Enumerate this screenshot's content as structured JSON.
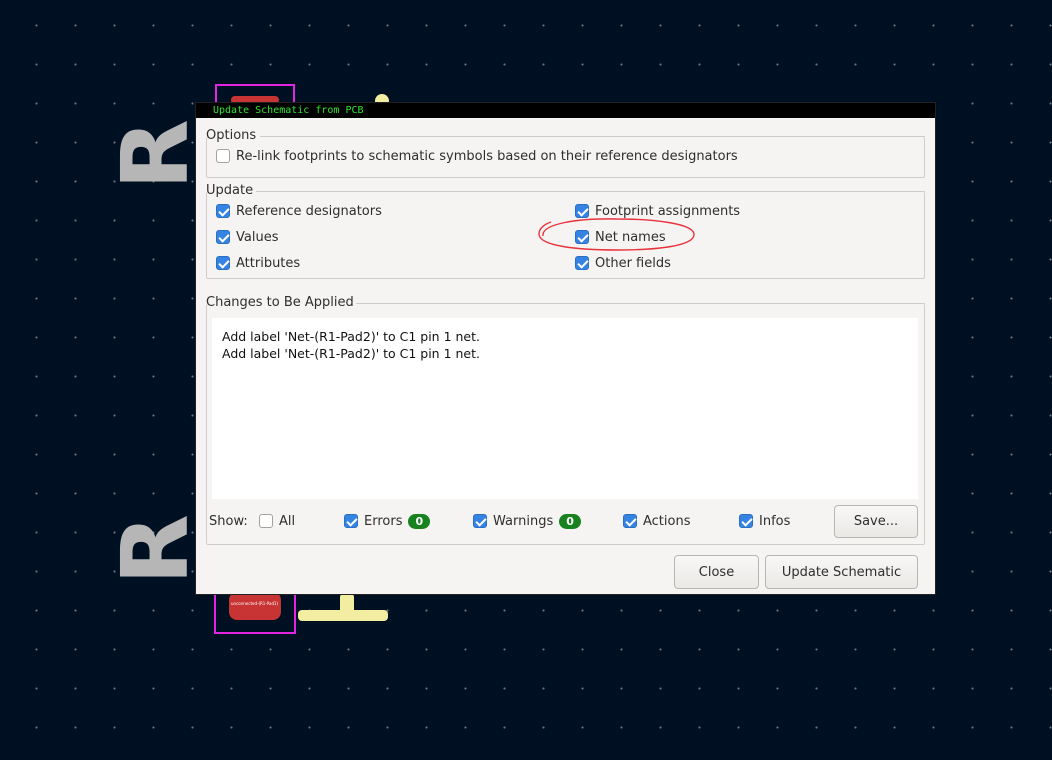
{
  "dialog": {
    "title": "Update Schematic from PCB"
  },
  "options": {
    "label": "Options",
    "relink": {
      "label": "Re-link footprints to schematic symbols based on their reference designators",
      "checked": false
    }
  },
  "update": {
    "label": "Update",
    "reference_designators": {
      "label": "Reference designators",
      "checked": true
    },
    "values": {
      "label": "Values",
      "checked": true
    },
    "attributes": {
      "label": "Attributes",
      "checked": true
    },
    "footprint_assignments": {
      "label": "Footprint assignments",
      "checked": true
    },
    "net_names": {
      "label": "Net names",
      "checked": true
    },
    "other_fields": {
      "label": "Other fields",
      "checked": true
    }
  },
  "changes": {
    "label": "Changes to Be Applied",
    "lines": [
      "Add label 'Net-(R1-Pad2)' to C1 pin 1 net.",
      "Add label 'Net-(R1-Pad2)' to C1 pin 1 net."
    ]
  },
  "filters": {
    "show_label": "Show:",
    "all": {
      "label": "All",
      "checked": false
    },
    "errors": {
      "label": "Errors",
      "checked": true,
      "count": "0"
    },
    "warnings": {
      "label": "Warnings",
      "checked": true,
      "count": "0"
    },
    "actions": {
      "label": "Actions",
      "checked": true
    },
    "infos": {
      "label": "Infos",
      "checked": true
    },
    "save_label": "Save..."
  },
  "buttons": {
    "close_label": "Close",
    "update_label": "Update Schematic"
  },
  "pcb": {
    "top_ref": "R",
    "bottom_ref": "R",
    "pad_net_text": "unconnected-(R1-Pad1)",
    "annotation_color": "#e8323c",
    "accent_color": "#3584e4"
  }
}
